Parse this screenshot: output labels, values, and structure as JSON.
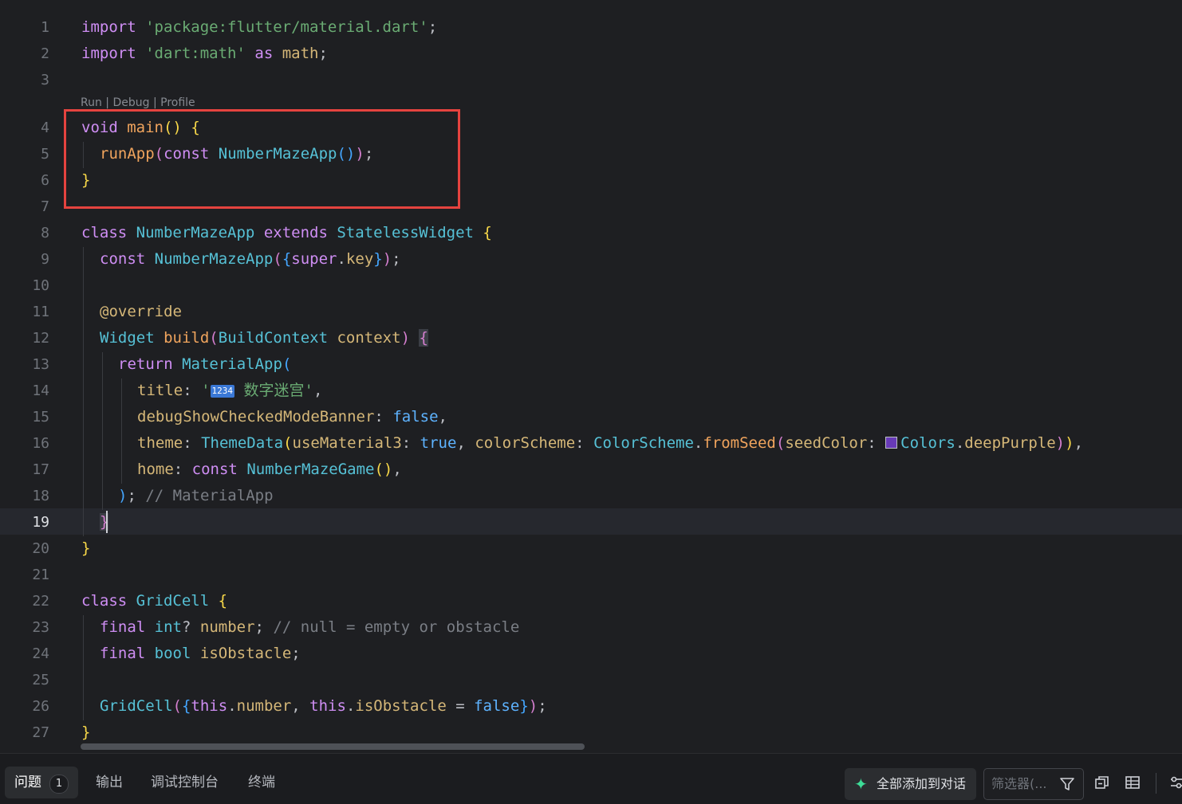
{
  "editor": {
    "codelens": "Run | Debug | Profile",
    "current_line": 19,
    "line_numbers": [
      "1",
      "2",
      "3",
      "4",
      "5",
      "6",
      "7",
      "8",
      "9",
      "10",
      "11",
      "12",
      "13",
      "14",
      "15",
      "16",
      "17",
      "18",
      "19",
      "20",
      "21",
      "22",
      "23",
      "24",
      "25",
      "26",
      "27"
    ],
    "lines": {
      "l1": [
        "import",
        " ",
        "'package:flutter/material.dart'",
        ";"
      ],
      "l2": [
        "import",
        " ",
        "'dart:math'",
        " ",
        "as",
        " ",
        "math",
        ";"
      ],
      "l4": [
        "void",
        " ",
        "main",
        "()",
        " ",
        "{"
      ],
      "l5": [
        "runApp",
        "(",
        "const",
        " ",
        "NumberMazeApp",
        "()",
        ")",
        ";"
      ],
      "l6": [
        "}"
      ],
      "l8": [
        "class",
        " ",
        "NumberMazeApp",
        " ",
        "extends",
        " ",
        "StatelessWidget",
        " ",
        "{"
      ],
      "l9": [
        "const",
        " ",
        "NumberMazeApp",
        "(",
        "{",
        "super",
        ".",
        "key",
        "}",
        ")",
        ";"
      ],
      "l11": [
        "@override"
      ],
      "l12": [
        "Widget",
        " ",
        "build",
        "(",
        "BuildContext",
        " ",
        "context",
        ")",
        " ",
        "{"
      ],
      "l13": [
        "return",
        " ",
        "MaterialApp",
        "("
      ],
      "l14": [
        "title",
        ": ",
        "'",
        "1234",
        " 数字迷宫'",
        ","
      ],
      "l15": [
        "debugShowCheckedModeBanner",
        ": ",
        "false",
        ","
      ],
      "l16": [
        "theme",
        ": ",
        "ThemeData",
        "(",
        "useMaterial3",
        ": ",
        "true",
        ", ",
        "colorScheme",
        ": ",
        "ColorScheme",
        ".",
        "fromSeed",
        "(",
        "seedColor",
        ": ",
        "Colors",
        ".",
        "deepPurple",
        ")",
        ")",
        ","
      ],
      "l17": [
        "home",
        ": ",
        "const",
        " ",
        "NumberMazeGame",
        "()",
        ","
      ],
      "l18": [
        ")",
        ";",
        " ",
        "// MaterialApp"
      ],
      "l19": [
        "}"
      ],
      "l20": [
        "}"
      ],
      "l22": [
        "class",
        " ",
        "GridCell",
        " ",
        "{"
      ],
      "l23": [
        "final",
        " ",
        "int",
        "?",
        " ",
        "number",
        ";",
        " ",
        "// null = empty or obstacle"
      ],
      "l24": [
        "final",
        " ",
        "bool",
        " ",
        "isObstacle",
        ";"
      ],
      "l26": [
        "GridCell",
        "(",
        "{",
        "this",
        ".",
        "number",
        ", ",
        "this",
        ".",
        "isObstacle",
        " = ",
        "false",
        "}",
        ")",
        ";"
      ],
      "l27": [
        "}"
      ]
    },
    "swatch_color": "#673ab7",
    "highlight_box_color": "#e5433f"
  },
  "panel": {
    "tabs": [
      {
        "label": "问题",
        "badge": "1"
      },
      {
        "label": "输出"
      },
      {
        "label": "调试控制台"
      },
      {
        "label": "终端"
      }
    ],
    "add_all_label": "全部添加到对话",
    "filter_placeholder": "筛选器(..."
  },
  "colors": {
    "background": "#1e1f22",
    "current_line": "#26282e",
    "keyword": "#cf8ef4",
    "string": "#6aab73",
    "class": "#56c1d6",
    "function": "#f0a45d",
    "comment": "#7a7e85"
  },
  "icons": [
    "sparkle-icon",
    "filter-icon",
    "collapse-all-icon",
    "table-view-icon",
    "settings-slider-icon"
  ]
}
